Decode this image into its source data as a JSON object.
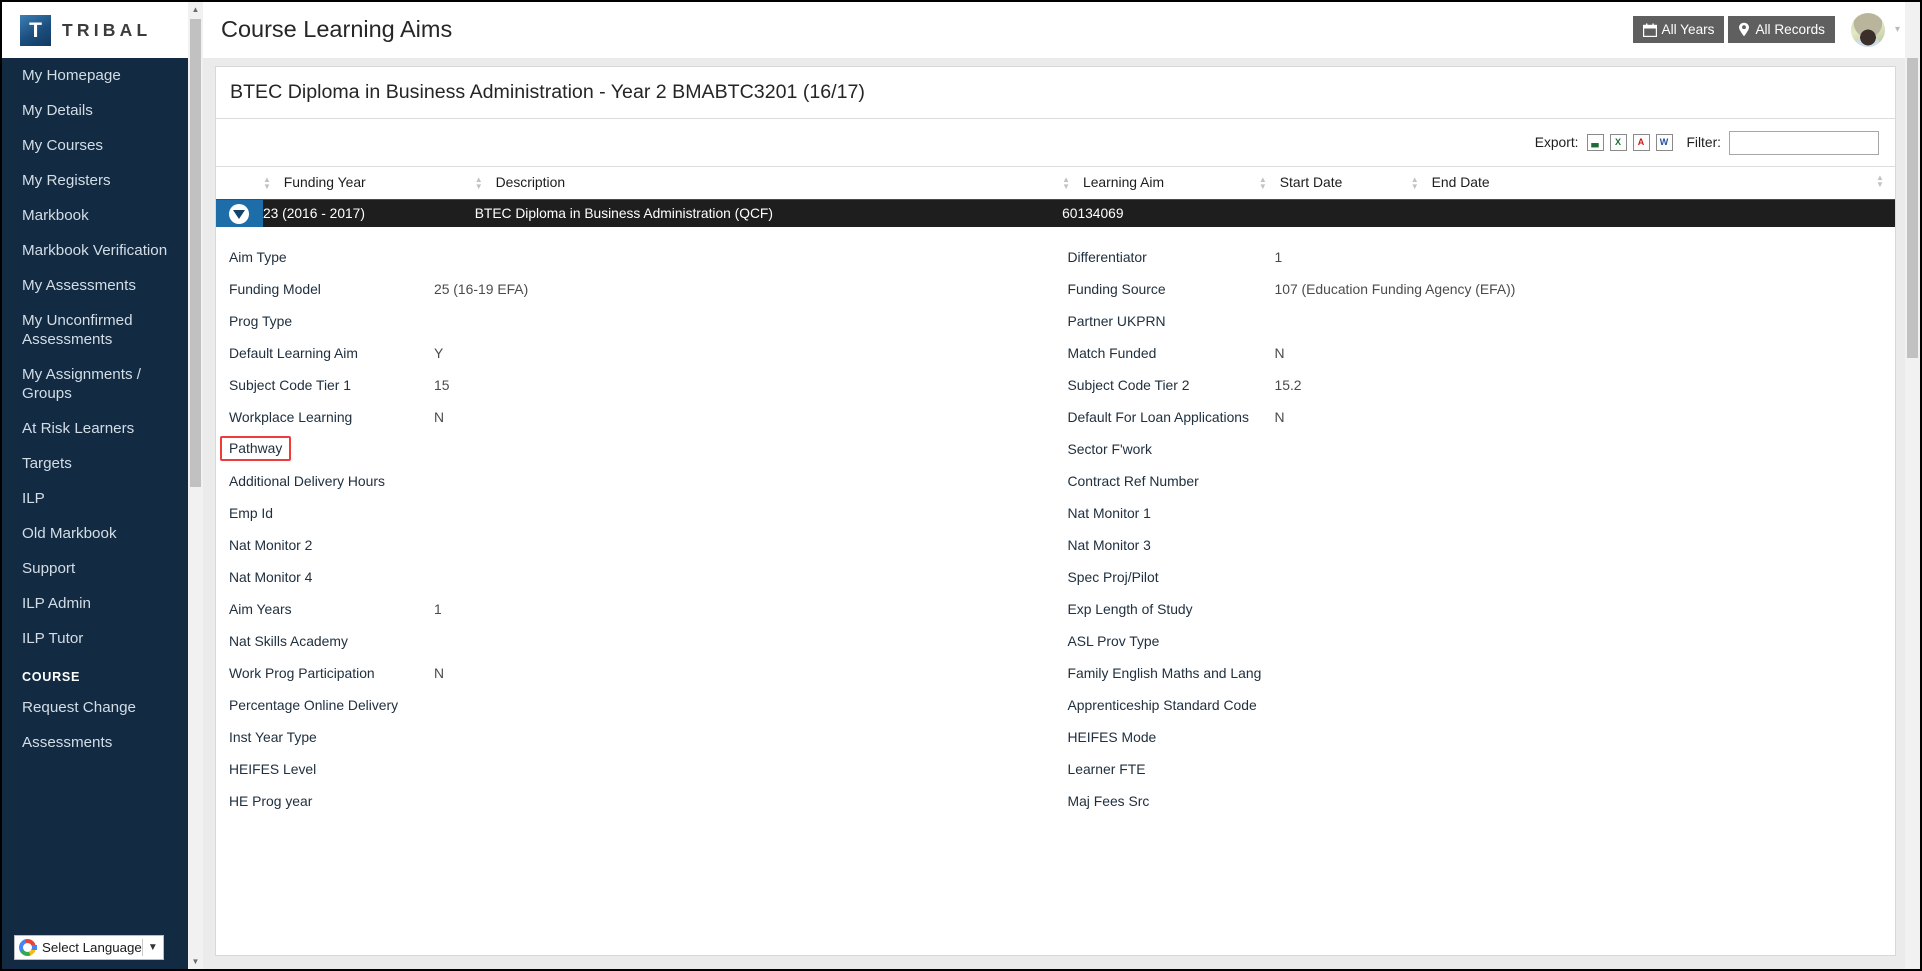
{
  "brand": {
    "mark": "T",
    "name": "TRIBAL"
  },
  "sidebar": {
    "items": [
      {
        "label": "My Homepage"
      },
      {
        "label": "My Details"
      },
      {
        "label": "My Courses"
      },
      {
        "label": "My Registers"
      },
      {
        "label": "Markbook"
      },
      {
        "label": "Markbook Verification"
      },
      {
        "label": "My Assessments"
      },
      {
        "label": "My Unconfirmed Assessments"
      },
      {
        "label": "My Assignments / Groups"
      },
      {
        "label": "At Risk Learners"
      },
      {
        "label": "Targets"
      },
      {
        "label": "ILP"
      },
      {
        "label": "Old Markbook"
      },
      {
        "label": "Support"
      },
      {
        "label": "ILP Admin"
      },
      {
        "label": "ILP Tutor"
      }
    ],
    "section_label": "COURSE",
    "section_items": [
      {
        "label": "Request Change"
      },
      {
        "label": "Assessments"
      }
    ],
    "language_widget": {
      "label": "Select Language",
      "caret": "▼",
      "icon": "google-g-icon"
    }
  },
  "topbar": {
    "title": "Course Learning Aims",
    "buttons": [
      {
        "label": "All Years",
        "icon": "calendar-icon"
      },
      {
        "label": "All Records",
        "icon": "map-pin-icon"
      }
    ],
    "avatar": "user-avatar",
    "caret": "▾"
  },
  "card": {
    "course_title": "BTEC Diploma in Business Administration - Year 2 BMABTC3201 (16/17)"
  },
  "toolbar": {
    "export_label": "Export:",
    "export_icons": [
      {
        "name": "export-csv-icon",
        "glyph": "▃"
      },
      {
        "name": "export-excel-icon",
        "glyph": "X"
      },
      {
        "name": "export-pdf-icon",
        "glyph": "A"
      },
      {
        "name": "export-word-icon",
        "glyph": "W"
      }
    ],
    "filter_label": "Filter:",
    "filter_value": "",
    "filter_placeholder": ""
  },
  "grid": {
    "columns": [
      {
        "label": "Funding Year",
        "sortable": true
      },
      {
        "label": "Description",
        "sortable": true
      },
      {
        "label": "Learning Aim",
        "sortable": true
      },
      {
        "label": "Start Date",
        "sortable": true
      },
      {
        "label": "End Date",
        "sortable": true
      }
    ],
    "selected_row": {
      "funding_year": "23 (2016 - 2017)",
      "description": "BTEC Diploma in Business Administration (QCF)",
      "learning_aim": "60134069",
      "start_date": "",
      "end_date": ""
    }
  },
  "detail": {
    "left": [
      {
        "label": "Aim Type",
        "value": ""
      },
      {
        "label": "Funding Model",
        "value": "25 (16-19 EFA)"
      },
      {
        "label": "Prog Type",
        "value": ""
      },
      {
        "label": "Default Learning Aim",
        "value": "Y"
      },
      {
        "label": "Subject Code Tier 1",
        "value": "15"
      },
      {
        "label": "Workplace Learning",
        "value": "N"
      },
      {
        "label": "Pathway",
        "value": "",
        "flagged": true
      },
      {
        "label": "Additional Delivery Hours",
        "value": ""
      },
      {
        "label": "Emp Id",
        "value": ""
      },
      {
        "label": "Nat Monitor 2",
        "value": ""
      },
      {
        "label": "Nat Monitor 4",
        "value": ""
      },
      {
        "label": "Aim Years",
        "value": "1"
      },
      {
        "label": "Nat Skills Academy",
        "value": ""
      },
      {
        "label": "Work Prog Participation",
        "value": "N"
      },
      {
        "label": "Percentage Online Delivery",
        "value": ""
      },
      {
        "label": "Inst Year Type",
        "value": ""
      },
      {
        "label": "HEIFES Level",
        "value": ""
      },
      {
        "label": "HE Prog year",
        "value": ""
      }
    ],
    "right": [
      {
        "label": "Differentiator",
        "value": "1"
      },
      {
        "label": "Funding Source",
        "value": "107 (Education Funding Agency (EFA))"
      },
      {
        "label": "Partner UKPRN",
        "value": ""
      },
      {
        "label": "Match Funded",
        "value": "N"
      },
      {
        "label": "Subject Code Tier 2",
        "value": "15.2"
      },
      {
        "label": "Default For Loan Applications",
        "value": "N"
      },
      {
        "label": "Sector F'work",
        "value": ""
      },
      {
        "label": "Contract Ref Number",
        "value": ""
      },
      {
        "label": "Nat Monitor 1",
        "value": ""
      },
      {
        "label": "Nat Monitor 3",
        "value": ""
      },
      {
        "label": "Spec Proj/Pilot",
        "value": ""
      },
      {
        "label": "Exp Length of Study",
        "value": ""
      },
      {
        "label": "ASL Prov Type",
        "value": ""
      },
      {
        "label": "Family English Maths and Lang",
        "value": ""
      },
      {
        "label": "Apprenticeship Standard Code",
        "value": ""
      },
      {
        "label": "HEIFES Mode",
        "value": ""
      },
      {
        "label": "Learner FTE",
        "value": ""
      },
      {
        "label": "Maj Fees Src",
        "value": ""
      }
    ]
  },
  "colors": {
    "sidebar_bg": "#122a42",
    "selected_row_bg": "#1e1e1e",
    "handle_cell_bg": "#1d6ea8",
    "flag_outline": "#ee3b3b",
    "top_button_bg": "#5f5f5f"
  }
}
